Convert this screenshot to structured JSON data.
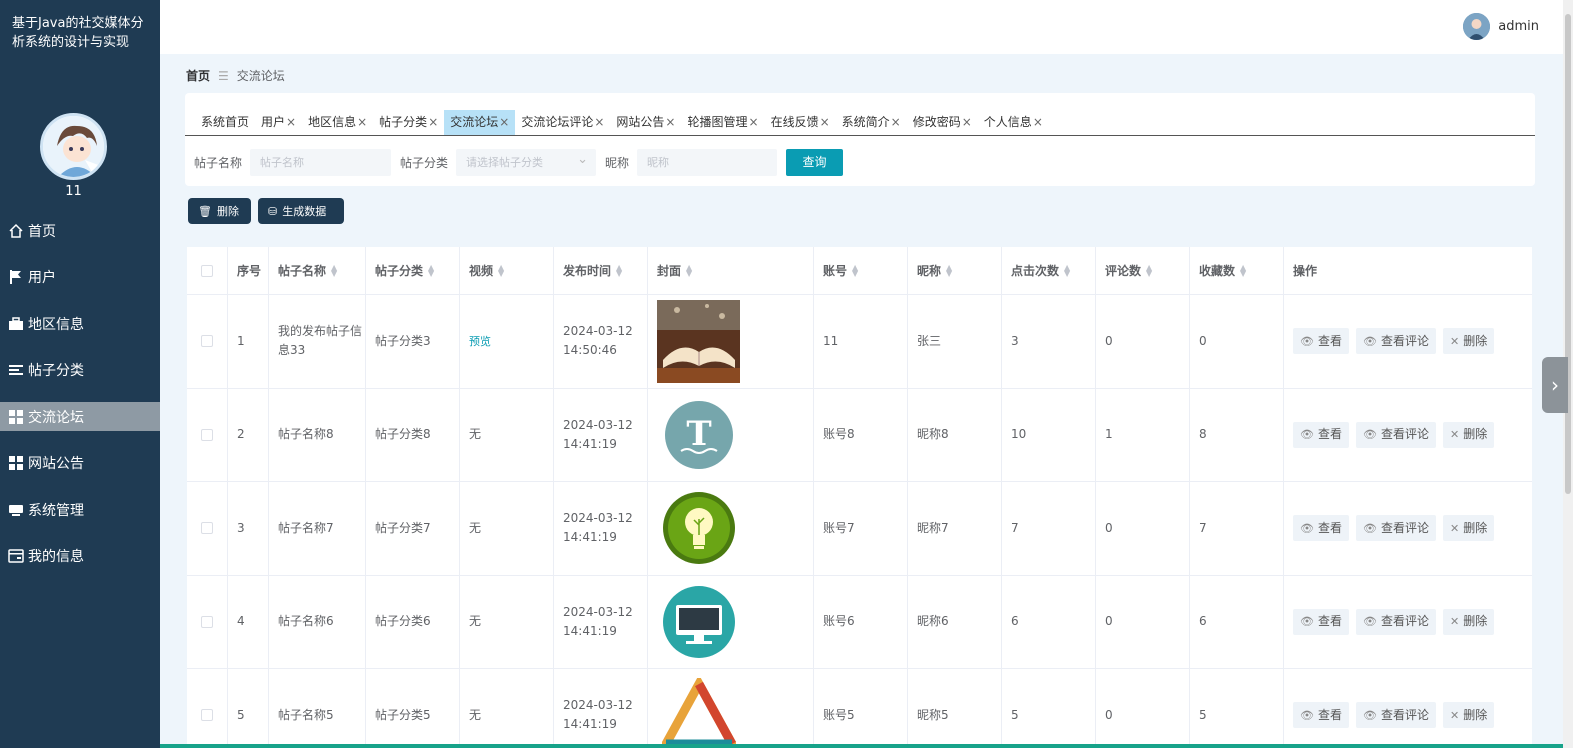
{
  "app": {
    "title": "基于Java的社交媒体分析系统的设计与实现",
    "user_num": "11"
  },
  "sidebar": {
    "items": [
      {
        "label": "首页",
        "icon": "home-icon"
      },
      {
        "label": "用户",
        "icon": "flag-icon"
      },
      {
        "label": "地区信息",
        "icon": "briefcase-icon"
      },
      {
        "label": "帖子分类",
        "icon": "list-icon"
      },
      {
        "label": "交流论坛",
        "icon": "grid-icon"
      },
      {
        "label": "网站公告",
        "icon": "grid-icon"
      },
      {
        "label": "系统管理",
        "icon": "printer-icon"
      },
      {
        "label": "我的信息",
        "icon": "card-icon"
      }
    ],
    "active": "交流论坛"
  },
  "header": {
    "username": "admin"
  },
  "breadcrumb": {
    "home": "首页",
    "current": "交流论坛"
  },
  "tabs": [
    {
      "label": "系统首页",
      "closable": false
    },
    {
      "label": "用户",
      "closable": true
    },
    {
      "label": "地区信息",
      "closable": true
    },
    {
      "label": "帖子分类",
      "closable": true
    },
    {
      "label": "交流论坛",
      "closable": true,
      "active": true
    },
    {
      "label": "交流论坛评论",
      "closable": true
    },
    {
      "label": "网站公告",
      "closable": true
    },
    {
      "label": "轮播图管理",
      "closable": true
    },
    {
      "label": "在线反馈",
      "closable": true
    },
    {
      "label": "系统简介",
      "closable": true
    },
    {
      "label": "修改密码",
      "closable": true
    },
    {
      "label": "个人信息",
      "closable": true
    }
  ],
  "search": {
    "title_label": "帖子名称",
    "title_placeholder": "帖子名称",
    "category_label": "帖子分类",
    "category_placeholder": "请选择帖子分类",
    "nick_label": "昵称",
    "nick_placeholder": "昵称",
    "query_button": "查询"
  },
  "actions": {
    "delete": "删除",
    "generate": "生成数据"
  },
  "table": {
    "headers": [
      "序号",
      "帖子名称",
      "帖子分类",
      "视频",
      "发布时间",
      "封面",
      "账号",
      "昵称",
      "点击次数",
      "评论数",
      "收藏数",
      "操作"
    ],
    "op_labels": {
      "view": "查看",
      "view_comments": "查看评论",
      "delete": "删除"
    },
    "rows": [
      {
        "no": "1",
        "title": "我的发布帖子信息33",
        "category": "帖子分类3",
        "video": "预览",
        "time": "2024-03-12 14:50:46",
        "cover": "book-image",
        "account": "11",
        "nick": "张三",
        "clicks": "3",
        "comments": "0",
        "favorites": "0"
      },
      {
        "no": "2",
        "title": "帖子名称8",
        "category": "帖子分类8",
        "video": "无",
        "time": "2024-03-12 14:41:19",
        "cover": "letter-t-icon",
        "account": "账号8",
        "nick": "昵称8",
        "clicks": "10",
        "comments": "1",
        "favorites": "8"
      },
      {
        "no": "3",
        "title": "帖子名称7",
        "category": "帖子分类7",
        "video": "无",
        "time": "2024-03-12 14:41:19",
        "cover": "lightbulb-icon",
        "account": "账号7",
        "nick": "昵称7",
        "clicks": "7",
        "comments": "0",
        "favorites": "7"
      },
      {
        "no": "4",
        "title": "帖子名称6",
        "category": "帖子分类6",
        "video": "无",
        "time": "2024-03-12 14:41:19",
        "cover": "monitor-icon",
        "account": "账号6",
        "nick": "昵称6",
        "clicks": "6",
        "comments": "0",
        "favorites": "6"
      },
      {
        "no": "5",
        "title": "帖子名称5",
        "category": "帖子分类5",
        "video": "无",
        "time": "2024-03-12 14:41:19",
        "cover": "triangle-icon",
        "account": "账号5",
        "nick": "昵称5",
        "clicks": "5",
        "comments": "0",
        "favorites": "5"
      }
    ]
  },
  "colors": {
    "sidebar": "#1f3b53",
    "accent": "#0a9cb3",
    "active_tab": "#b7e1f7"
  }
}
